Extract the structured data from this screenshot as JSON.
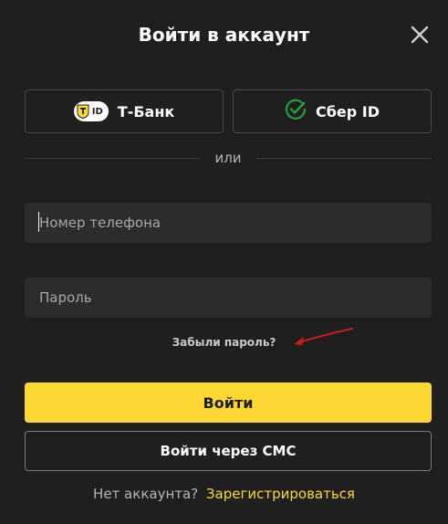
{
  "modal": {
    "title": "Войти в аккаунт",
    "close_icon": "close-icon"
  },
  "providers": {
    "tbank": {
      "label": "Т-Банк",
      "logo_text": "ID",
      "icon": "tbank-id-logo"
    },
    "sber": {
      "label": "Сбер ID",
      "icon": "sber-check-icon",
      "color": "#21a038"
    }
  },
  "divider": {
    "text": "или"
  },
  "form": {
    "phone_placeholder": "Номер телефона",
    "phone_value": "",
    "password_placeholder": "Пароль",
    "password_value": "",
    "forgot_label": "Забыли пароль?"
  },
  "buttons": {
    "login_label": "Войти",
    "sms_label": "Войти через СМС"
  },
  "footer": {
    "question": "Нет аккаунта?",
    "register_label": "Зарегистрироваться"
  },
  "colors": {
    "accent": "#fdd835",
    "background": "#1f1f1f",
    "annotation_arrow": "#d01c1c"
  }
}
